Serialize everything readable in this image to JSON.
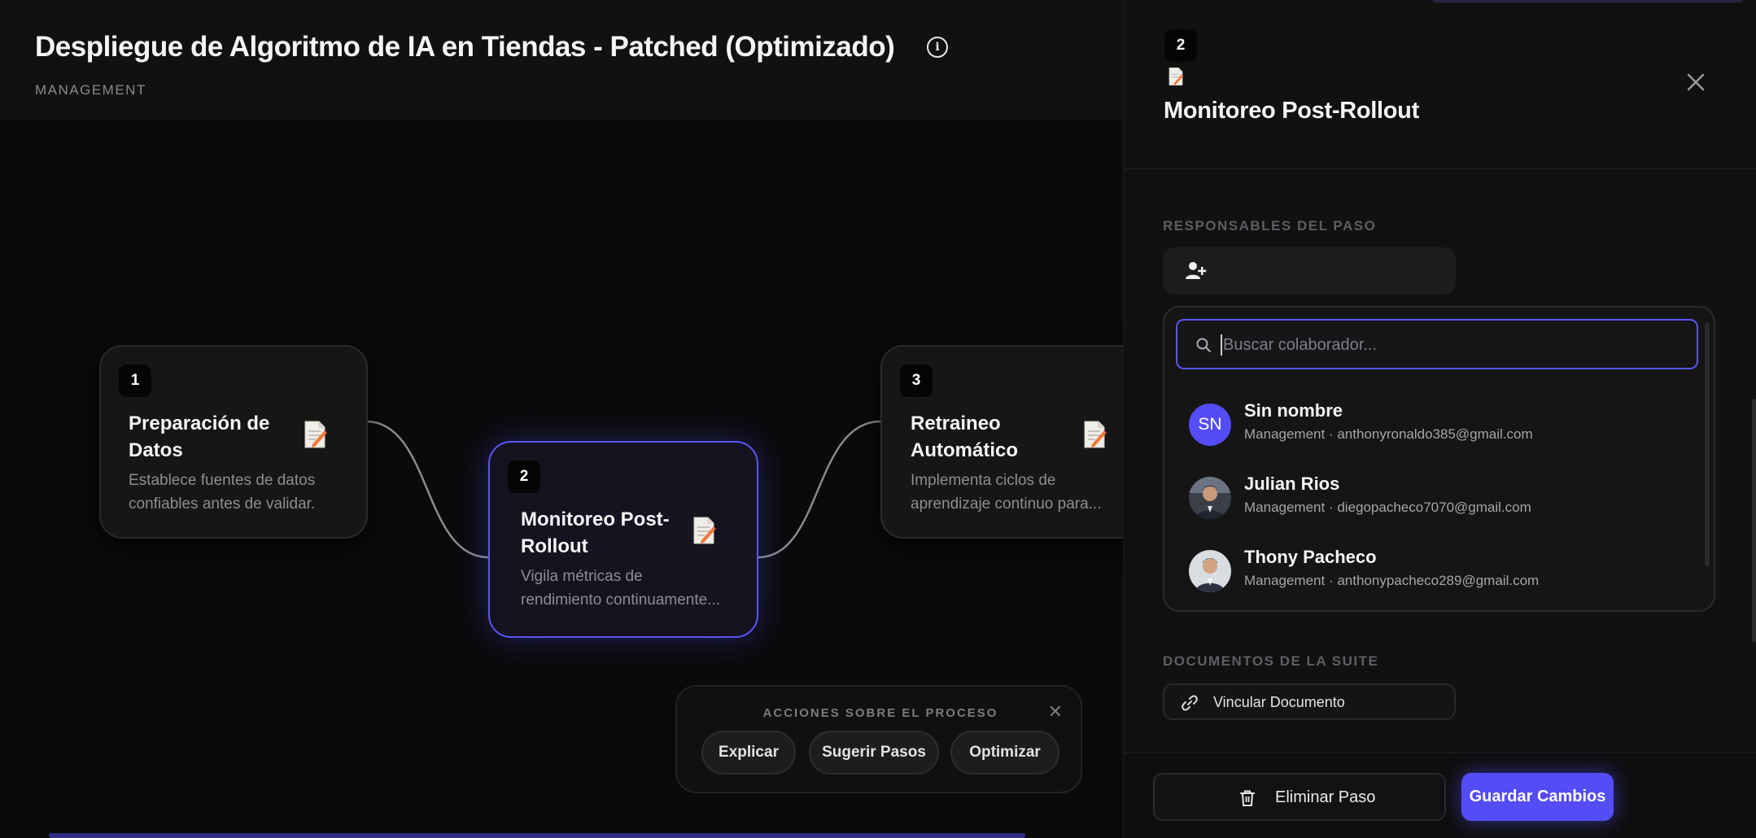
{
  "header": {
    "title": "Despliegue de Algoritmo de IA en Tiendas - Patched (Optimizado)",
    "subtitle": "MANAGEMENT",
    "info_icon": "info-icon"
  },
  "nodes": [
    {
      "number": "1",
      "title": "Preparación de Datos",
      "description_lines": [
        "Establece fuentes de datos",
        "confiables antes de validar."
      ],
      "icon": "document-edit-icon",
      "active": false
    },
    {
      "number": "2",
      "title": "Monitoreo Post-Rollout",
      "description_lines": [
        "Vigila métricas de",
        "rendimiento continuamente..."
      ],
      "icon": "document-edit-icon",
      "active": true
    },
    {
      "number": "3",
      "title": "Retraineo Automático",
      "description_lines": [
        "Implementa ciclos de",
        "aprendizaje continuo para..."
      ],
      "icon": "document-edit-icon",
      "active": false
    }
  ],
  "actions_panel": {
    "title": "ACCIONES SOBRE EL PROCESO",
    "close_icon": "close-icon",
    "buttons": [
      "Explicar",
      "Sugerir Pasos",
      "Optimizar"
    ]
  },
  "detail": {
    "step_number": "2",
    "step_title": "Monitoreo Post-Rollout",
    "owners_label": "RESPONSABLES DEL PASO",
    "add_owner_icon": "user-plus-icon",
    "search": {
      "placeholder": "Buscar colaborador...",
      "value": ""
    },
    "collaborators": [
      {
        "name": "Sin nombre",
        "initials": "SN",
        "meta": "Management · anthonyronaldo385@gmail.com",
        "avatar": "initials"
      },
      {
        "name": "Julian Rios",
        "initials": "",
        "meta": "Management · diegopacheco7070@gmail.com",
        "avatar": "photo"
      },
      {
        "name": "Thony Pacheco",
        "initials": "",
        "meta": "Management · anthonypacheco289@gmail.com",
        "avatar": "photo"
      }
    ],
    "docs_label": "DOCUMENTOS DE LA SUITE",
    "link_doc_label": "Vincular Documento",
    "delete_label": "Eliminar Paso",
    "save_label": "Guardar Cambios"
  },
  "colors": {
    "accent": "#544cf5",
    "background": "#0a0a0b",
    "panel": "#111112",
    "muted_text": "#8d8d93"
  }
}
